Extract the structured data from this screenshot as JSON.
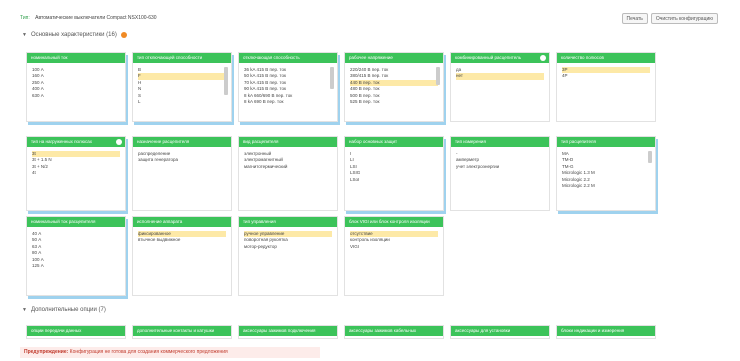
{
  "topbar": {
    "prefix": "Тип:",
    "title": "Автоматические выключатели Compact NSX100-630",
    "btn_print": "Печать",
    "btn_clear": "Очистить конфигурацию"
  },
  "main_section": {
    "label": "Основные характеристики (16)"
  },
  "extra_section": {
    "label": "Дополнительные опции (7)"
  },
  "cards": [
    {
      "title": "номинальный ток",
      "options": [
        "100 А",
        "160 А",
        "250 А",
        "400 А",
        "630 А"
      ],
      "selected": []
    },
    {
      "title": "тип отключающей способности",
      "options": [
        "B",
        "F",
        "H",
        "N",
        "S",
        "L"
      ],
      "selected": [
        1
      ]
    },
    {
      "title": "отключающая способность",
      "options": [
        "36 kA 415 В пер. ток",
        "50 kA 415 В пер. ток",
        "70 kA 415 В пер. ток",
        "90 kA 415 В пер. ток",
        "8 kA 660/690 В пер. ток",
        "8 kA 690 В пер. ток"
      ],
      "selected": []
    },
    {
      "title": "рабочее напряжение",
      "options": [
        "220/240 В пер. ток",
        "380/415 В пер. ток",
        "440 В пер. ток",
        "480 В пер. ток",
        "500 В пер. ток",
        "525 В пер. ток"
      ],
      "selected": [
        2
      ]
    },
    {
      "title": "комбинированный расцепитель",
      "options": [
        "да",
        "нет"
      ],
      "selected": [
        1
      ]
    },
    {
      "title": "количество полюсов",
      "options": [
        "3P",
        "4P"
      ],
      "selected": [
        0
      ]
    },
    {
      "title": "тип на нагруженных полюсах",
      "options": [
        "3t",
        "3t + 1.5 N",
        "3t + N/2",
        "4t"
      ],
      "selected": [
        0
      ]
    },
    {
      "title": "назначение расцепителя",
      "options": [
        "распределение",
        "защита генератора"
      ],
      "selected": []
    },
    {
      "title": "вид расцепителя",
      "options": [
        "электронный",
        "электромагнитный",
        "магнитотермический"
      ],
      "selected": []
    },
    {
      "title": "набор основных защит",
      "options": [
        "I",
        "LI",
        "LSI",
        "LSIG",
        "LSoI"
      ],
      "selected": []
    },
    {
      "title": "тип измерения",
      "options": [
        "-",
        "амперметр",
        "учет электроэнергии"
      ],
      "selected": []
    },
    {
      "title": "тип расцепителя",
      "options": [
        "MA",
        "TM-D",
        "TM-G",
        "Micrologic 1.3 M",
        "Micrologic 2.2",
        "Micrologic 2.2 M"
      ],
      "selected": []
    },
    {
      "title": "номинальный ток расцепителя",
      "options": [
        "40 А",
        "50 А",
        "63 А",
        "80 А",
        "100 А",
        "125 А"
      ],
      "selected": []
    },
    {
      "title": "исполнение аппарата",
      "options": [
        "фиксированное",
        "втычное выдвижное"
      ],
      "selected": [
        0
      ]
    },
    {
      "title": "тип управления",
      "options": [
        "ручное управление",
        "поворотная рукоятка",
        "мотор-редуктор"
      ],
      "selected": [
        0
      ]
    },
    {
      "title": "блок VIGI или блок контроля изоляции",
      "options": [
        "отсутствие",
        "контроль изоляции",
        "VIGI"
      ],
      "selected": [
        0
      ]
    }
  ],
  "extra_cards": [
    "опции передачи данных",
    "дополнительные контакты и катушки",
    "аксессуары зажимов подключения",
    "аксессуары зажимов кабельных",
    "аксессуары для установки",
    "блоки индикации и измерения"
  ],
  "warning": {
    "label": "Предупреждение:",
    "text": "Конфигурация не готова для создания коммерческого предложения"
  },
  "colors": {
    "card_header": "#3cc35a",
    "selected": "#fde9a7",
    "accent_orange": "#f08a24",
    "shadow": "#9fd2ee"
  }
}
